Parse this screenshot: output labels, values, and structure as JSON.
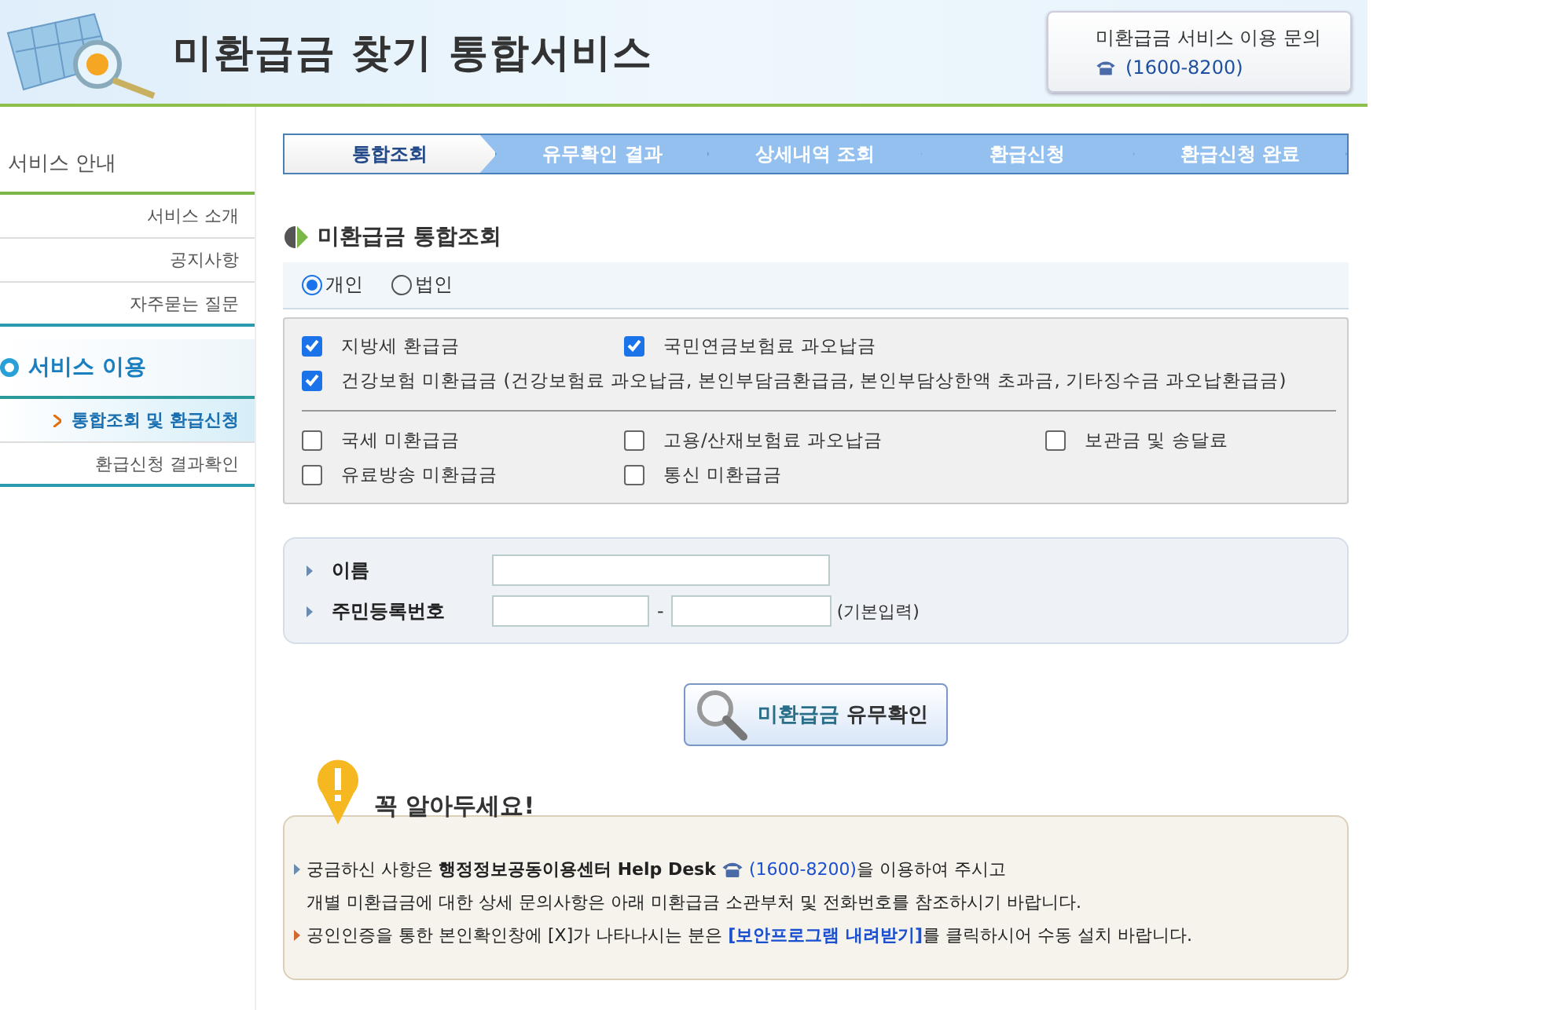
{
  "header": {
    "title": "미환급금 찾기 통합서비스",
    "contact": {
      "label": "미환급금 서비스 이용 문의",
      "phone": "(1600-8200)"
    }
  },
  "sidebar": {
    "sections": [
      {
        "title": "서비스 안내",
        "active": false,
        "items": [
          {
            "label": "서비스 소개",
            "selected": false
          },
          {
            "label": "공지사항",
            "selected": false
          },
          {
            "label": "자주묻는 질문",
            "selected": false
          }
        ]
      },
      {
        "title": "서비스 이용",
        "active": true,
        "items": [
          {
            "label": "통합조회 및 환급신청",
            "selected": true
          },
          {
            "label": "환급신청 결과확인",
            "selected": false
          }
        ]
      }
    ]
  },
  "steps": [
    {
      "label": "통합조회",
      "selected": true
    },
    {
      "label": "유무확인 결과",
      "selected": false
    },
    {
      "label": "상세내역 조회",
      "selected": false
    },
    {
      "label": "환급신청",
      "selected": false
    },
    {
      "label": "환급신청 완료",
      "selected": false
    }
  ],
  "section_title": "미환급금 통합조회",
  "member_types": [
    {
      "label": "개인",
      "selected": true
    },
    {
      "label": "법인",
      "selected": false
    }
  ],
  "refund_groups": [
    [
      {
        "label": "지방세 환급금",
        "checked": true
      },
      {
        "label": "국민연금보험료 과오납금",
        "checked": true
      },
      {
        "label": "건강보험 미환급금 (건강보험료 과오납금, 본인부담금환급금, 본인부담상한액 초과금, 기타징수금 과오납환급금)",
        "checked": true,
        "wide": true
      }
    ],
    [
      {
        "label": "국세 미환급금",
        "checked": false
      },
      {
        "label": "고용/산재보험료 과오납금",
        "checked": false
      },
      {
        "label": "보관금 및 송달료",
        "checked": false
      },
      {
        "label": "유료방송 미환급금",
        "checked": false
      },
      {
        "label": "통신 미환급금",
        "checked": false
      }
    ]
  ],
  "form": {
    "name_label": "이름",
    "id_label": "주민등록번호",
    "id_separator": "-",
    "id_note": "(기본입력)"
  },
  "check_button": {
    "highlight": "미환급금",
    "text": "유무확인"
  },
  "notice": {
    "title": "꼭 알아두세요!",
    "notes": [
      {
        "before": "궁금하신 사항은 **행정정보공동이용센터 Help Desk** ",
        "phone": "(1600-8200)",
        "after": "을 이용하여 주시고",
        "continuation": "개별 미환급금에 대한 상세 문의사항은 아래 미환급금 소관부처 및 전화번호를 참조하시기 바랍니다."
      },
      {
        "before": "공인인증을 통한 본인확인창에 [X]가 나타나시는 분은 ",
        "link": "[보안프로그램 내려받기]",
        "after": "를 클릭하시어 수동 설치 바랍니다."
      }
    ]
  }
}
